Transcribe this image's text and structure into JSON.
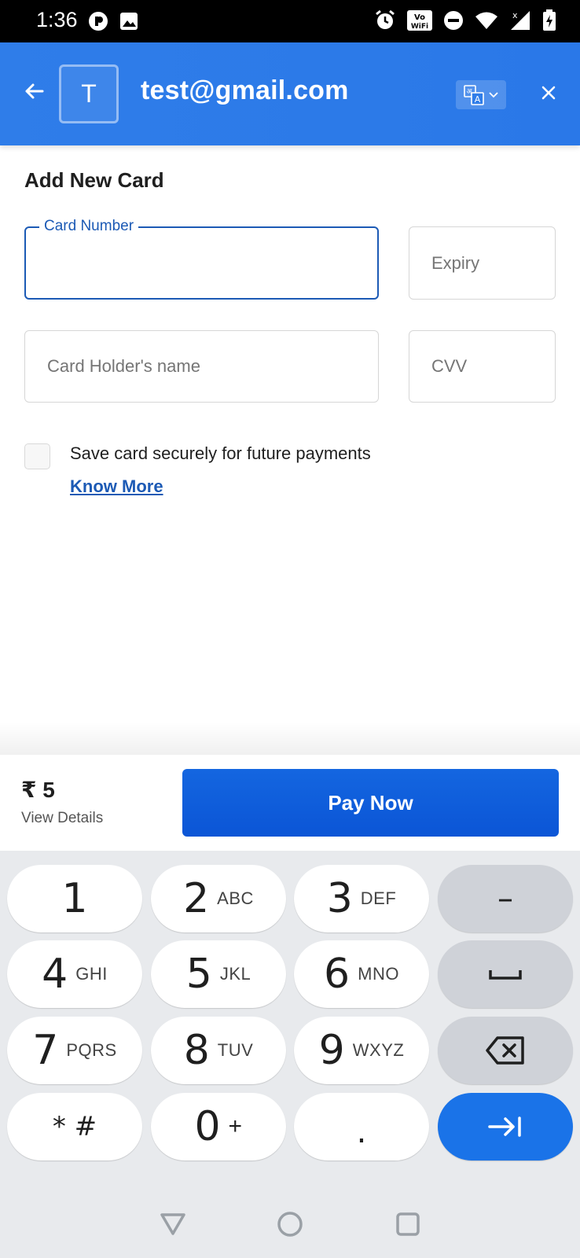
{
  "status_bar": {
    "time": "1:36"
  },
  "header": {
    "avatar_letter": "T",
    "email": "test@gmail.com"
  },
  "form": {
    "title": "Add New Card",
    "card_number_label": "Card Number",
    "card_number_value": "",
    "expiry_placeholder": "Expiry",
    "holder_placeholder": "Card Holder's name",
    "cvv_placeholder": "CVV",
    "save_card_label": "Save card securely for future payments",
    "save_card_checked": false,
    "know_more": "Know More"
  },
  "payment": {
    "amount": "₹ 5",
    "view_details": "View Details",
    "pay_button": "Pay Now"
  },
  "keyboard": {
    "keys": [
      {
        "main": "1",
        "sub": ""
      },
      {
        "main": "2",
        "sub": "ABC"
      },
      {
        "main": "3",
        "sub": "DEF"
      },
      {
        "main": "–",
        "sub": ""
      },
      {
        "main": "4",
        "sub": "GHI"
      },
      {
        "main": "5",
        "sub": "JKL"
      },
      {
        "main": "6",
        "sub": "MNO"
      },
      {
        "main": "",
        "sub": ""
      },
      {
        "main": "7",
        "sub": "PQRS"
      },
      {
        "main": "8",
        "sub": "TUV"
      },
      {
        "main": "9",
        "sub": "WXYZ"
      },
      {
        "main": "",
        "sub": ""
      },
      {
        "main": "* #",
        "sub": ""
      },
      {
        "main": "0",
        "sub": "+"
      },
      {
        "main": ".",
        "sub": ""
      },
      {
        "main": "",
        "sub": ""
      }
    ]
  },
  "colors": {
    "header_blue": "#2f7de9",
    "pay_button_blue": "#0b55d6",
    "focus_blue": "#1c5ab5",
    "keyboard_bg": "#e8eaed",
    "go_key_blue": "#1a73e8"
  }
}
